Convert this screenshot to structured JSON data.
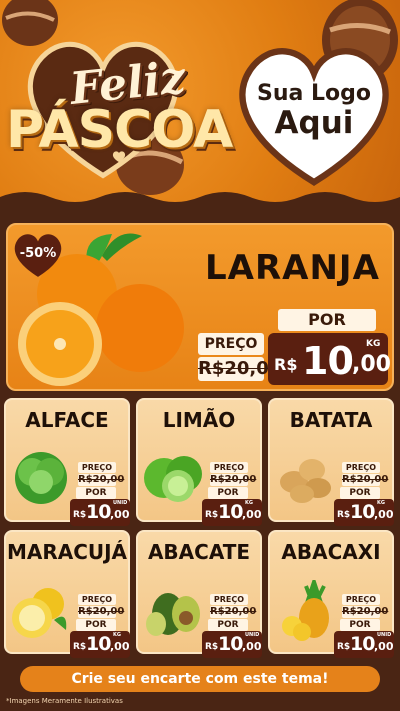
{
  "header": {
    "title_line1": "Feliz",
    "title_line2": "PÁSCOA",
    "logo_line1": "Sua Logo",
    "logo_line2": "Aqui"
  },
  "hero": {
    "product": "LARANJA",
    "discount": "-50%",
    "preco_label": "PREÇO",
    "old_price": "R$20,00",
    "por_label": "POR",
    "currency": "R$",
    "price_int": "10",
    "price_dec": ",00",
    "unit": "KG"
  },
  "products": [
    {
      "name": "ALFACE",
      "preco_label": "PREÇO",
      "old_price": "R$20,00",
      "por_label": "POR",
      "currency": "R$",
      "price_int": "10",
      "price_dec": ",00",
      "unit": "UNID"
    },
    {
      "name": "LIMÃO",
      "preco_label": "PREÇO",
      "old_price": "R$20,00",
      "por_label": "POR",
      "currency": "R$",
      "price_int": "10",
      "price_dec": ",00",
      "unit": "KG"
    },
    {
      "name": "BATATA",
      "preco_label": "PREÇO",
      "old_price": "R$20,00",
      "por_label": "POR",
      "currency": "R$",
      "price_int": "10",
      "price_dec": ",00",
      "unit": "KG"
    },
    {
      "name": "MARACUJÁ",
      "preco_label": "PREÇO",
      "old_price": "R$20,00",
      "por_label": "POR",
      "currency": "R$",
      "price_int": "10",
      "price_dec": ",00",
      "unit": "KG"
    },
    {
      "name": "ABACATE",
      "preco_label": "PREÇO",
      "old_price": "R$20,00",
      "por_label": "POR",
      "currency": "R$",
      "price_int": "10",
      "price_dec": ",00",
      "unit": "UNID"
    },
    {
      "name": "ABACAXI",
      "preco_label": "PREÇO",
      "old_price": "R$20,00",
      "por_label": "POR",
      "currency": "R$",
      "price_int": "10",
      "price_dec": ",00",
      "unit": "UNID"
    }
  ],
  "footer": {
    "cta": "Crie seu encarte com este tema!",
    "disclaimer": "*Imagens Meramente Ilustrativas"
  },
  "colors": {
    "orange": "#e78316",
    "chocolate": "#5a1f10",
    "cream": "#f9d9a8"
  }
}
